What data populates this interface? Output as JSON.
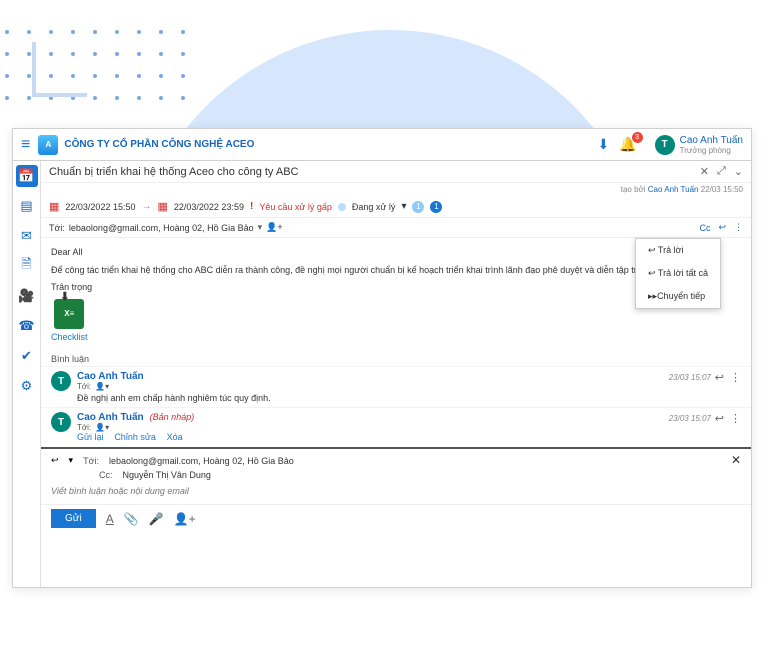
{
  "header": {
    "company": "CÔNG TY CỔ PHẦN CÔNG NGHỆ ACEO",
    "notif_count": "3",
    "user_initial": "T",
    "user_name": "Cao Anh Tuấn",
    "user_role": "Trưởng phòng"
  },
  "email": {
    "subject": "Chuẩn bị triển khai hệ thống Aceo cho công ty ABC",
    "created_label": "tạo bởi",
    "created_by": "Cao Anh Tuấn",
    "created_at": "22/03 15:50",
    "date_start": "22/03/2022 15:50",
    "date_end": "22/03/2022 23:59",
    "urgent": "Yêu cầu xử lý gấp",
    "status": "Đang xử lý",
    "count1": "1",
    "count2": "1",
    "to_label": "Tới:",
    "recipients": "lebaolong@gmail.com, Hoàng 02, Hồ Gia Bảo",
    "cc_label": "Cc",
    "greeting": "Dear All",
    "body_text": "Để công tác triển khai hệ thống cho ABC diễn ra thành công, đề nghị mọi người chuẩn bị kế hoạch triển khai trình lãnh đạo phê duyệt và diễn tập trước.",
    "closing": "Trân trọng",
    "attachment": "Checklist",
    "comments_label": "Bình luận"
  },
  "dropdown": {
    "reply": "Trả lời",
    "reply_all": "Trả lời tất cả",
    "forward": "Chuyển tiếp"
  },
  "comments": [
    {
      "initial": "T",
      "name": "Cao Anh Tuấn",
      "to_label": "Tới:",
      "text": "Đề nghị anh em chấp hành nghiêm túc quy định.",
      "time": "23/03 15:07"
    },
    {
      "initial": "T",
      "name": "Cao Anh Tuấn",
      "draft": "(Bản nháp)",
      "to_label": "Tới:",
      "link_resend": "Gửi lại",
      "link_edit": "Chỉnh sửa",
      "link_delete": "Xóa",
      "time": "23/03 15:07"
    }
  ],
  "compose": {
    "to_label": "Tới:",
    "to_value": "lebaolong@gmail.com, Hoàng 02, Hồ Gia Bảo",
    "cc_label": "Cc:",
    "cc_value": "Nguyễn Thị Vân Dung",
    "placeholder": "Viết bình luận hoặc nội dung email",
    "send": "Gửi"
  }
}
